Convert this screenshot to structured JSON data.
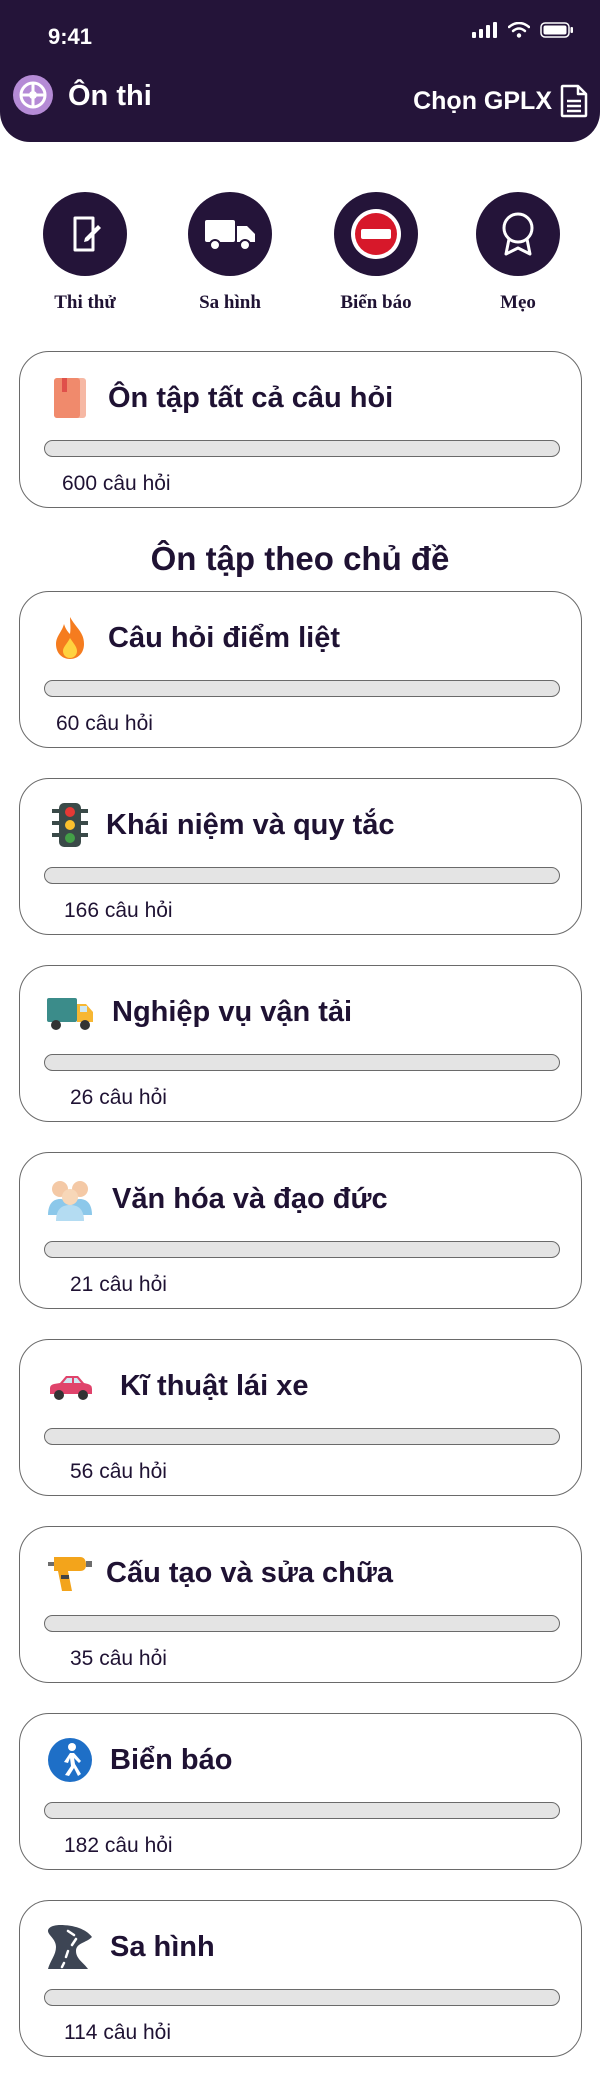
{
  "status_bar": {
    "time": "9:41"
  },
  "header": {
    "title": "Ôn thi",
    "select_label": "Chọn GPLX"
  },
  "quick_actions": [
    {
      "label": "Thi thử",
      "icon": "exam-edit-icon"
    },
    {
      "label": "Sa hình",
      "icon": "truck-icon"
    },
    {
      "label": "Biển báo",
      "icon": "no-entry-sign-icon"
    },
    {
      "label": "Mẹo",
      "icon": "award-badge-icon"
    }
  ],
  "review_all": {
    "title": "Ôn tập tất cả câu hỏi",
    "count": "600 câu hỏi",
    "progress": 0
  },
  "section_title": "Ôn tập theo chủ đề",
  "topics": [
    {
      "title": "Câu hỏi điểm liệt",
      "count": "60 câu hỏi",
      "icon": "fire-icon",
      "progress": 0
    },
    {
      "title": "Khái niệm và quy tắc",
      "count": "166 câu hỏi",
      "icon": "traffic-light-icon",
      "progress": 0
    },
    {
      "title": "Nghiệp vụ vận tải",
      "count": "26 câu hỏi",
      "icon": "delivery-truck-icon",
      "progress": 0
    },
    {
      "title": "Văn hóa và đạo đức",
      "count": "21 câu hỏi",
      "icon": "people-icon",
      "progress": 0
    },
    {
      "title": "Kĩ thuật lái xe",
      "count": "56 câu hỏi",
      "icon": "car-icon",
      "progress": 0
    },
    {
      "title": "Cấu tạo và sửa chữa",
      "count": "35 câu hỏi",
      "icon": "drill-icon",
      "progress": 0
    },
    {
      "title": "Biển báo",
      "count": "182 câu hỏi",
      "icon": "pedestrian-sign-icon",
      "progress": 0
    },
    {
      "title": "Sa hình",
      "count": "114 câu hỏi",
      "icon": "road-icon",
      "progress": 0
    }
  ],
  "colors": {
    "header_bg": "#241439",
    "primary_text": "#1f1233",
    "bar_bg": "#e4e4e4",
    "card_border": "#6a6a6a"
  }
}
